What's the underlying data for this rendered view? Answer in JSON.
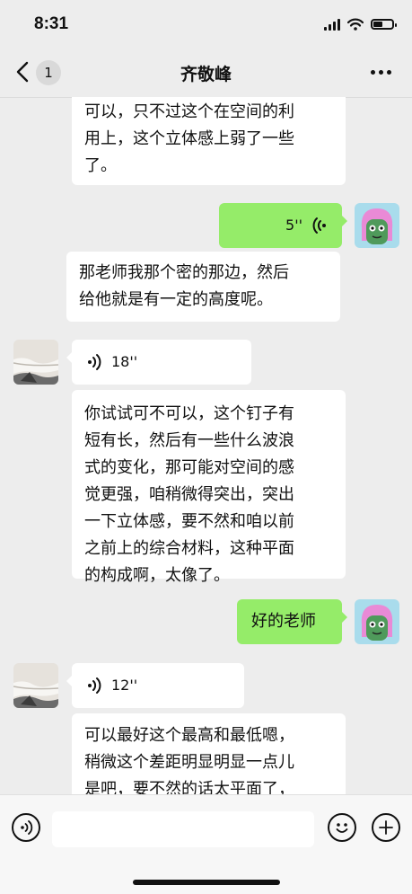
{
  "status": {
    "time": "8:31",
    "battery_level": 0.5
  },
  "nav": {
    "unread_count": "1",
    "contact_name": "齐敬峰"
  },
  "messages": {
    "m1": "可以，只不过这个在空间的利\n用上，这个立体感上弱了一些\n了。",
    "m2_duration": "5''",
    "m3": "那老师我那个密的那边，然后\n给他就是有一定的高度呢。",
    "m4_duration": "18''",
    "m5": "你试试可不可以，这个钉子有\n短有长，然后有一些什么波浪\n式的变化，那可能对空间的感\n觉更强，咱稍微得突出，突出\n一下立体感，要不然和咱以前\n之前上的综合材料，这种平面\n的构成啊，太像了。",
    "m6": "好的老师",
    "m7_duration": "12''",
    "m8": "可以最好这个最高和最低嗯，\n稍微这个差距明显明显一点儿\n是吧，要不然的话太平面了，"
  },
  "input": {
    "placeholder": ""
  },
  "colors": {
    "self_bubble": "#95ec69",
    "other_bubble": "#ffffff",
    "background": "#ededed"
  },
  "icons": {
    "back": "chevron-left-icon",
    "more": "more-icon",
    "voice_toggle": "voice-icon",
    "emoji": "emoji-icon",
    "add": "plus-icon",
    "wave": "voice-wave-icon"
  }
}
